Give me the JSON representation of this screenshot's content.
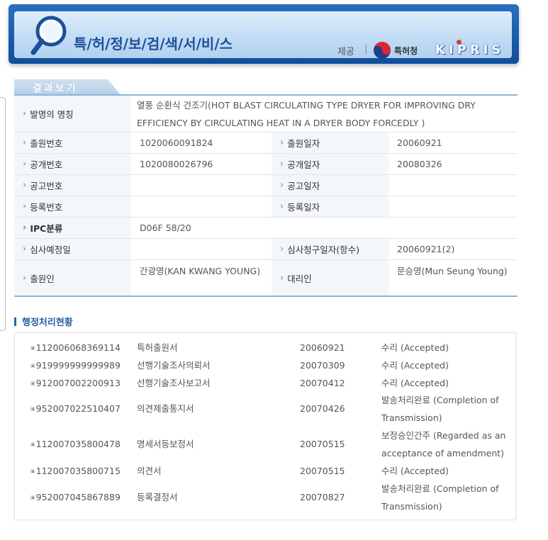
{
  "header": {
    "title": "특/허/정/보/검/색/서/비/스",
    "provider_label": "제공",
    "separator": "|",
    "agency_name": "특허청",
    "brand": "KIPRIS",
    "brand_color": "#1d4f9a"
  },
  "result": {
    "tab_label": "결과보기",
    "invention_title_label": "발명의 명칭",
    "invention_title_value": "열풍 순환식 건조기(HOT BLAST CIRCULATING TYPE DRYER FOR IMPROVING DRY EFFICIENCY BY CIRCULATING HEAT IN A DRYER BODY FORCEDLY )",
    "application_number_label": "출원번호",
    "application_number_value": "1020060091824",
    "application_date_label": "출원일자",
    "application_date_value": "20060921",
    "publication_number_label": "공개번호",
    "publication_number_value": "1020080026796",
    "publication_date_label": "공개일자",
    "publication_date_value": "20080326",
    "announcement_number_label": "공고번호",
    "announcement_number_value": "",
    "announcement_date_label": "공고일자",
    "announcement_date_value": "",
    "registration_number_label": "등록번호",
    "registration_number_value": "",
    "registration_date_label": "등록일자",
    "registration_date_value": "",
    "ipc_label": "IPC분류",
    "ipc_value": "D06F 58/20",
    "exam_scheduled_label": "심사예정일",
    "exam_scheduled_value": "",
    "exam_request_label": "심사청구일자(항수)",
    "exam_request_value": "20060921(2)",
    "applicant_label": "출원인",
    "applicant_value": "간광영(KAN KWANG YOUNG)",
    "agent_label": "대리인",
    "agent_value": "문승영(Mun Seung Young)"
  },
  "admin": {
    "title": "행정처리현황",
    "rows": [
      {
        "number": "112006068369114",
        "document": "특허출원서",
        "date": "20060921",
        "status": "수리 (Accepted)"
      },
      {
        "number": "919999999999989",
        "document": "선행기술조사의뢰서",
        "date": "20070309",
        "status": "수리 (Accepted)"
      },
      {
        "number": "912007002200913",
        "document": "선행기술조사보고서",
        "date": "20070412",
        "status": "수리 (Accepted)"
      },
      {
        "number": "952007022510407",
        "document": "의견제출통지서",
        "date": "20070426",
        "status": "발송처리완료 (Completion of Transmission)"
      },
      {
        "number": "112007035800478",
        "document": "명세서등보정서",
        "date": "20070515",
        "status": "보정승인간주 (Regarded as an acceptance of amendment)"
      },
      {
        "number": "112007035800715",
        "document": "의견서",
        "date": "20070515",
        "status": "수리 (Accepted)"
      },
      {
        "number": "952007045867889",
        "document": "등록결정서",
        "date": "20070827",
        "status": "발송처리완료 (Completion of Transmission)"
      }
    ]
  }
}
